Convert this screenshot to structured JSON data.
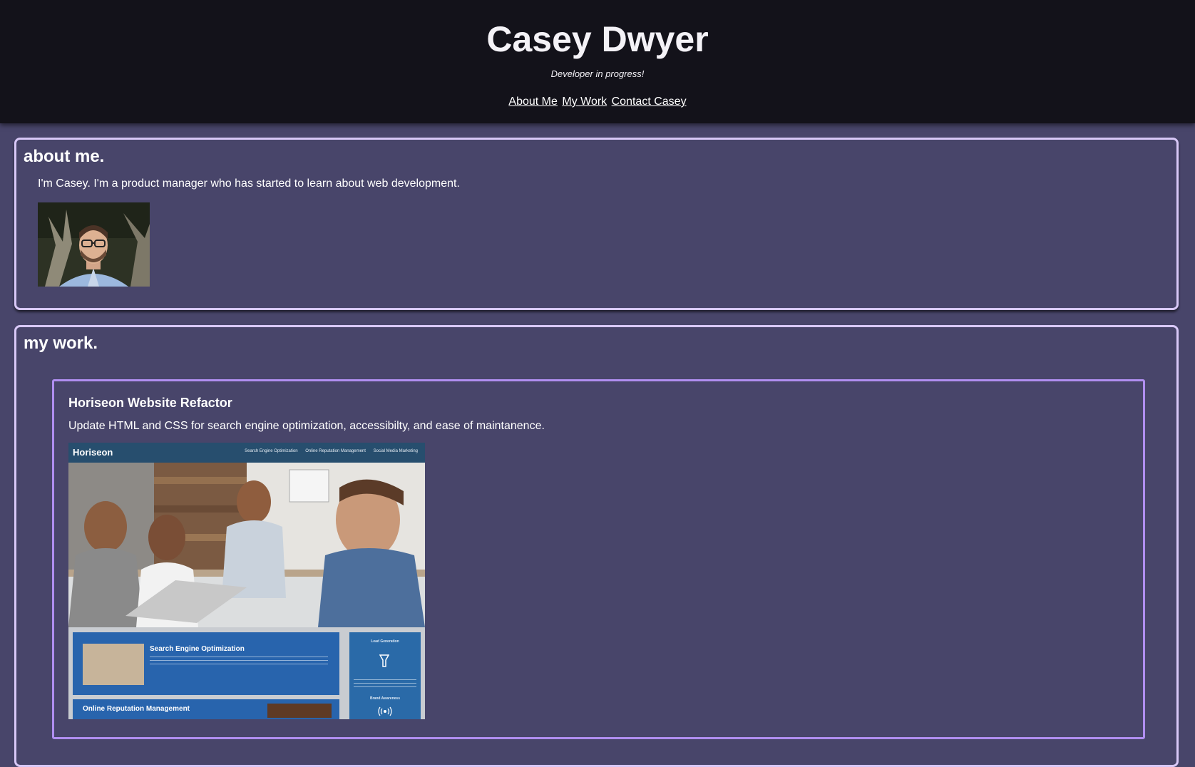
{
  "header": {
    "title": "Casey Dwyer",
    "tagline": "Developer in progress!",
    "nav": [
      "About Me",
      "My Work",
      "Contact Casey"
    ]
  },
  "about": {
    "heading": "about me.",
    "text": "I'm Casey. I'm a product manager who has started to learn about web development."
  },
  "work": {
    "heading": "my work.",
    "projects": [
      {
        "title": "Horiseon Website Refactor",
        "description": "Update HTML and CSS for search engine optimization, accessibilty, and ease of maintanence.",
        "screenshot": {
          "logo": "Horiseon",
          "nav": [
            "Search Engine Optimization",
            "Online Reputation Management",
            "Social Media Marketing"
          ],
          "cards": [
            "Search Engine Optimization",
            "Online Reputation Management"
          ],
          "sidebar": [
            "Lead Generation",
            "Brand Awareness"
          ]
        }
      }
    ]
  },
  "colors": {
    "header_bg": "#13121a",
    "page_bg": "#48456a",
    "panel_border": "#d8c8f7",
    "project_border": "#b08ef0"
  }
}
